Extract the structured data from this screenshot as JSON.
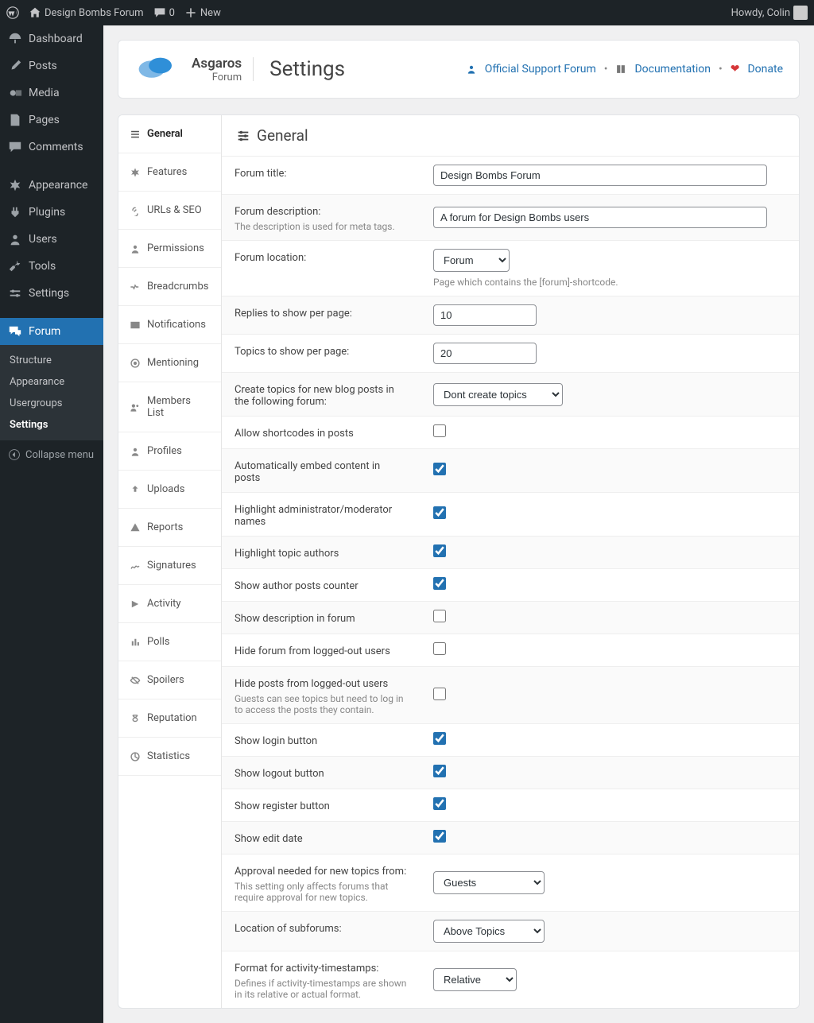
{
  "topbar": {
    "site_name": "Design Bombs Forum",
    "comments_count": "0",
    "new_label": "New",
    "howdy": "Howdy, Colin"
  },
  "admin_nav": {
    "dashboard": "Dashboard",
    "posts": "Posts",
    "media": "Media",
    "pages": "Pages",
    "comments": "Comments",
    "appearance": "Appearance",
    "plugins": "Plugins",
    "users": "Users",
    "tools": "Tools",
    "settings": "Settings",
    "forum": "Forum",
    "sub": {
      "structure": "Structure",
      "appearance": "Appearance",
      "usergroups": "Usergroups",
      "settings": "Settings"
    },
    "collapse": "Collapse menu"
  },
  "header": {
    "brand_name": "Asgaros",
    "brand_sub": "Forum",
    "page_title": "Settings",
    "links": {
      "support": "Official Support Forum",
      "docs": "Documentation",
      "donate": "Donate"
    }
  },
  "tabs": {
    "general": "General",
    "features": "Features",
    "urls": "URLs & SEO",
    "permissions": "Permissions",
    "breadcrumbs": "Breadcrumbs",
    "notifications": "Notifications",
    "mentioning": "Mentioning",
    "members": "Members List",
    "profiles": "Profiles",
    "uploads": "Uploads",
    "reports": "Reports",
    "signatures": "Signatures",
    "activity": "Activity",
    "polls": "Polls",
    "spoilers": "Spoilers",
    "reputation": "Reputation",
    "statistics": "Statistics"
  },
  "section_title": "General",
  "fields": {
    "title": {
      "label": "Forum title:",
      "value": "Design Bombs Forum"
    },
    "desc": {
      "label": "Forum description:",
      "help": "The description is used for meta tags.",
      "value": "A forum for Design Bombs users"
    },
    "location": {
      "label": "Forum location:",
      "value": "Forum",
      "help": "Page which contains the [forum]-shortcode."
    },
    "replies": {
      "label": "Replies to show per page:",
      "value": "10"
    },
    "topics": {
      "label": "Topics to show per page:",
      "value": "20"
    },
    "create_topics": {
      "label": "Create topics for new blog posts in the following forum:",
      "value": "Dont create topics"
    },
    "shortcodes": {
      "label": "Allow shortcodes in posts",
      "checked": false
    },
    "embed": {
      "label": "Automatically embed content in posts",
      "checked": true
    },
    "highlight_mod": {
      "label": "Highlight administrator/moderator names",
      "checked": true
    },
    "highlight_author": {
      "label": "Highlight topic authors",
      "checked": true
    },
    "posts_counter": {
      "label": "Show author posts counter",
      "checked": true
    },
    "show_desc": {
      "label": "Show description in forum",
      "checked": false
    },
    "hide_forum": {
      "label": "Hide forum from logged-out users",
      "checked": false
    },
    "hide_posts": {
      "label": "Hide posts from logged-out users",
      "help": "Guests can see topics but need to log in to access the posts they contain.",
      "checked": false
    },
    "login_btn": {
      "label": "Show login button",
      "checked": true
    },
    "logout_btn": {
      "label": "Show logout button",
      "checked": true
    },
    "register_btn": {
      "label": "Show register button",
      "checked": true
    },
    "edit_date": {
      "label": "Show edit date",
      "checked": true
    },
    "approval": {
      "label": "Approval needed for new topics from:",
      "help": "This setting only affects forums that require approval for new topics.",
      "value": "Guests"
    },
    "subforums": {
      "label": "Location of subforums:",
      "value": "Above Topics"
    },
    "timestamps": {
      "label": "Format for activity-timestamps:",
      "help": "Defines if activity-timestamps are shown in its relative or actual format.",
      "value": "Relative"
    }
  }
}
